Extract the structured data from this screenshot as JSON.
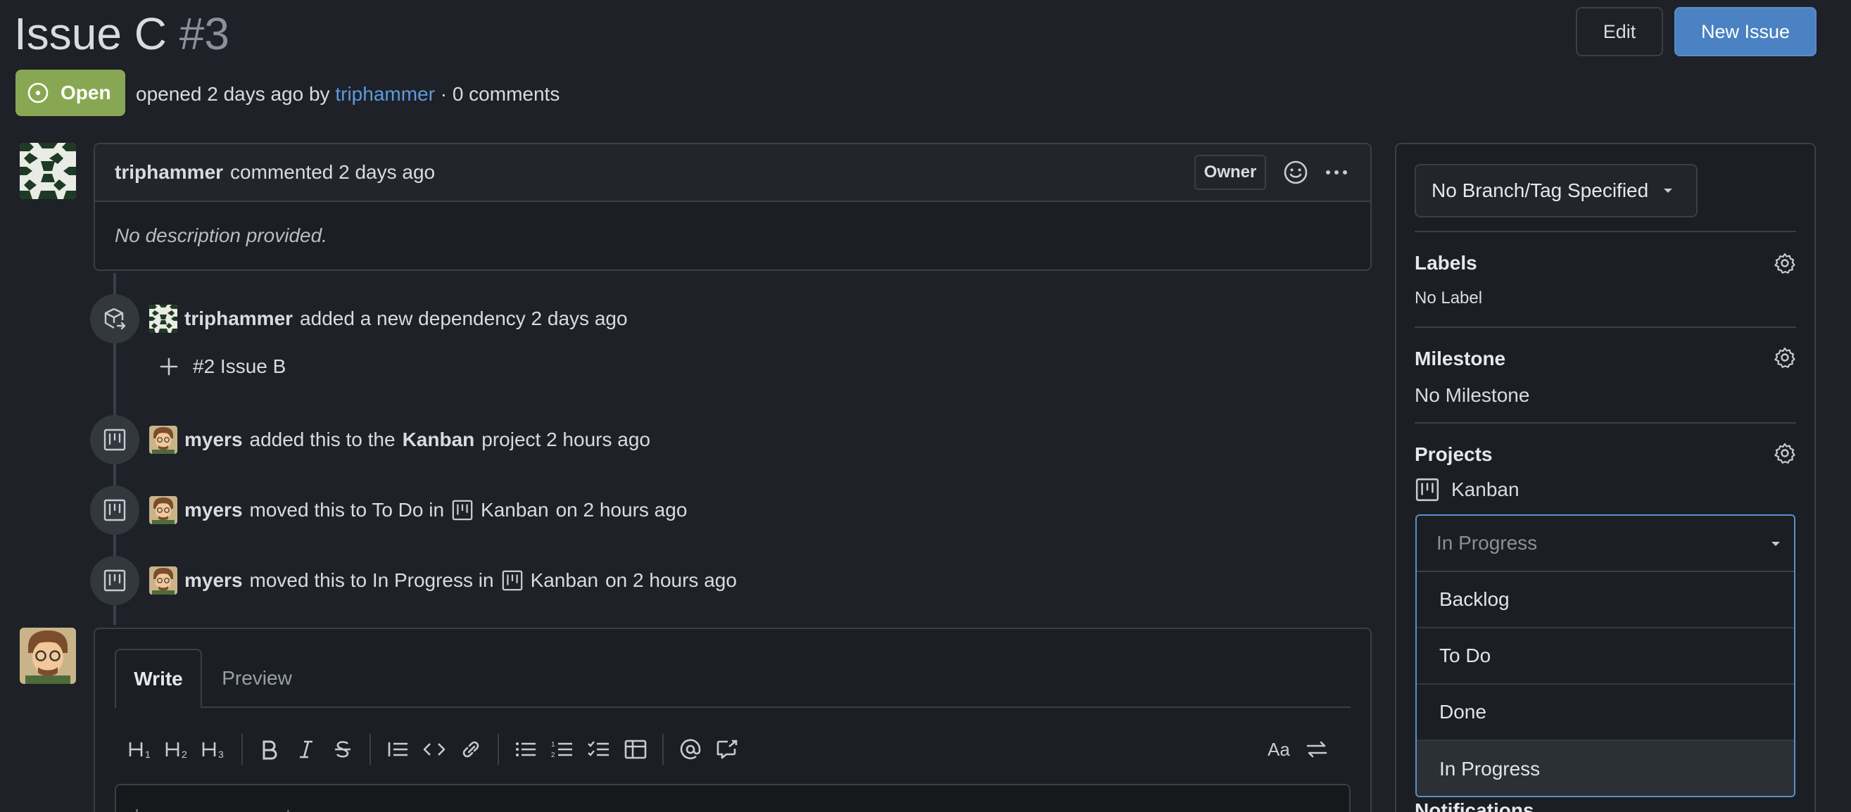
{
  "issue": {
    "title": "Issue C",
    "number": "#3",
    "state": "Open",
    "opened_text": "opened 2 days ago by",
    "author": "triphammer",
    "comments_text": "· 0 comments"
  },
  "header": {
    "edit_label": "Edit",
    "new_issue_label": "New Issue"
  },
  "comment": {
    "author": "triphammer",
    "action": "commented 2 days ago",
    "role_badge": "Owner",
    "body": "No description provided."
  },
  "timeline": [
    {
      "icon": "dependency-icon",
      "user": "triphammer",
      "text": "added a new dependency 2 days ago"
    },
    {
      "icon": "project-icon",
      "user": "myers",
      "text_before": "added this to the",
      "project": "Kanban",
      "text_after": "project 2 hours ago"
    },
    {
      "icon": "project-icon",
      "user": "myers",
      "text_before": "moved this to To Do in",
      "project": "Kanban",
      "text_after": "on 2 hours ago"
    },
    {
      "icon": "project-icon",
      "user": "myers",
      "text_before": "moved this to In Progress in",
      "project": "Kanban",
      "text_after": "on 2 hours ago"
    }
  ],
  "dependency": {
    "ref": "#2 Issue B"
  },
  "editor": {
    "tab_write": "Write",
    "tab_preview": "Preview",
    "placeholder": "Leave a comment",
    "toolbar": [
      "heading-1-icon",
      "heading-2-icon",
      "heading-3-icon",
      "bold-icon",
      "italic-icon",
      "strikethrough-icon",
      "quote-icon",
      "code-icon",
      "link-icon",
      "bullet-list-icon",
      "numbered-list-icon",
      "task-list-icon",
      "table-icon",
      "mention-icon",
      "reference-icon",
      "font-toggle-icon",
      "switch-editor-icon"
    ]
  },
  "sidebar": {
    "branch_label": "No Branch/Tag Specified",
    "labels_heading": "Labels",
    "labels_value": "No Label",
    "milestone_heading": "Milestone",
    "milestone_value": "No Milestone",
    "projects_heading": "Projects",
    "project_name": "Kanban",
    "column_select": {
      "selected": "In Progress",
      "options": [
        "Backlog",
        "To Do",
        "Done",
        "In Progress"
      ]
    },
    "notifications_heading": "Notifications"
  },
  "colors": {
    "background": "#1e2127",
    "accent_blue": "#4a82c3",
    "open_green": "#88a752",
    "link": "#5b9bdc"
  }
}
